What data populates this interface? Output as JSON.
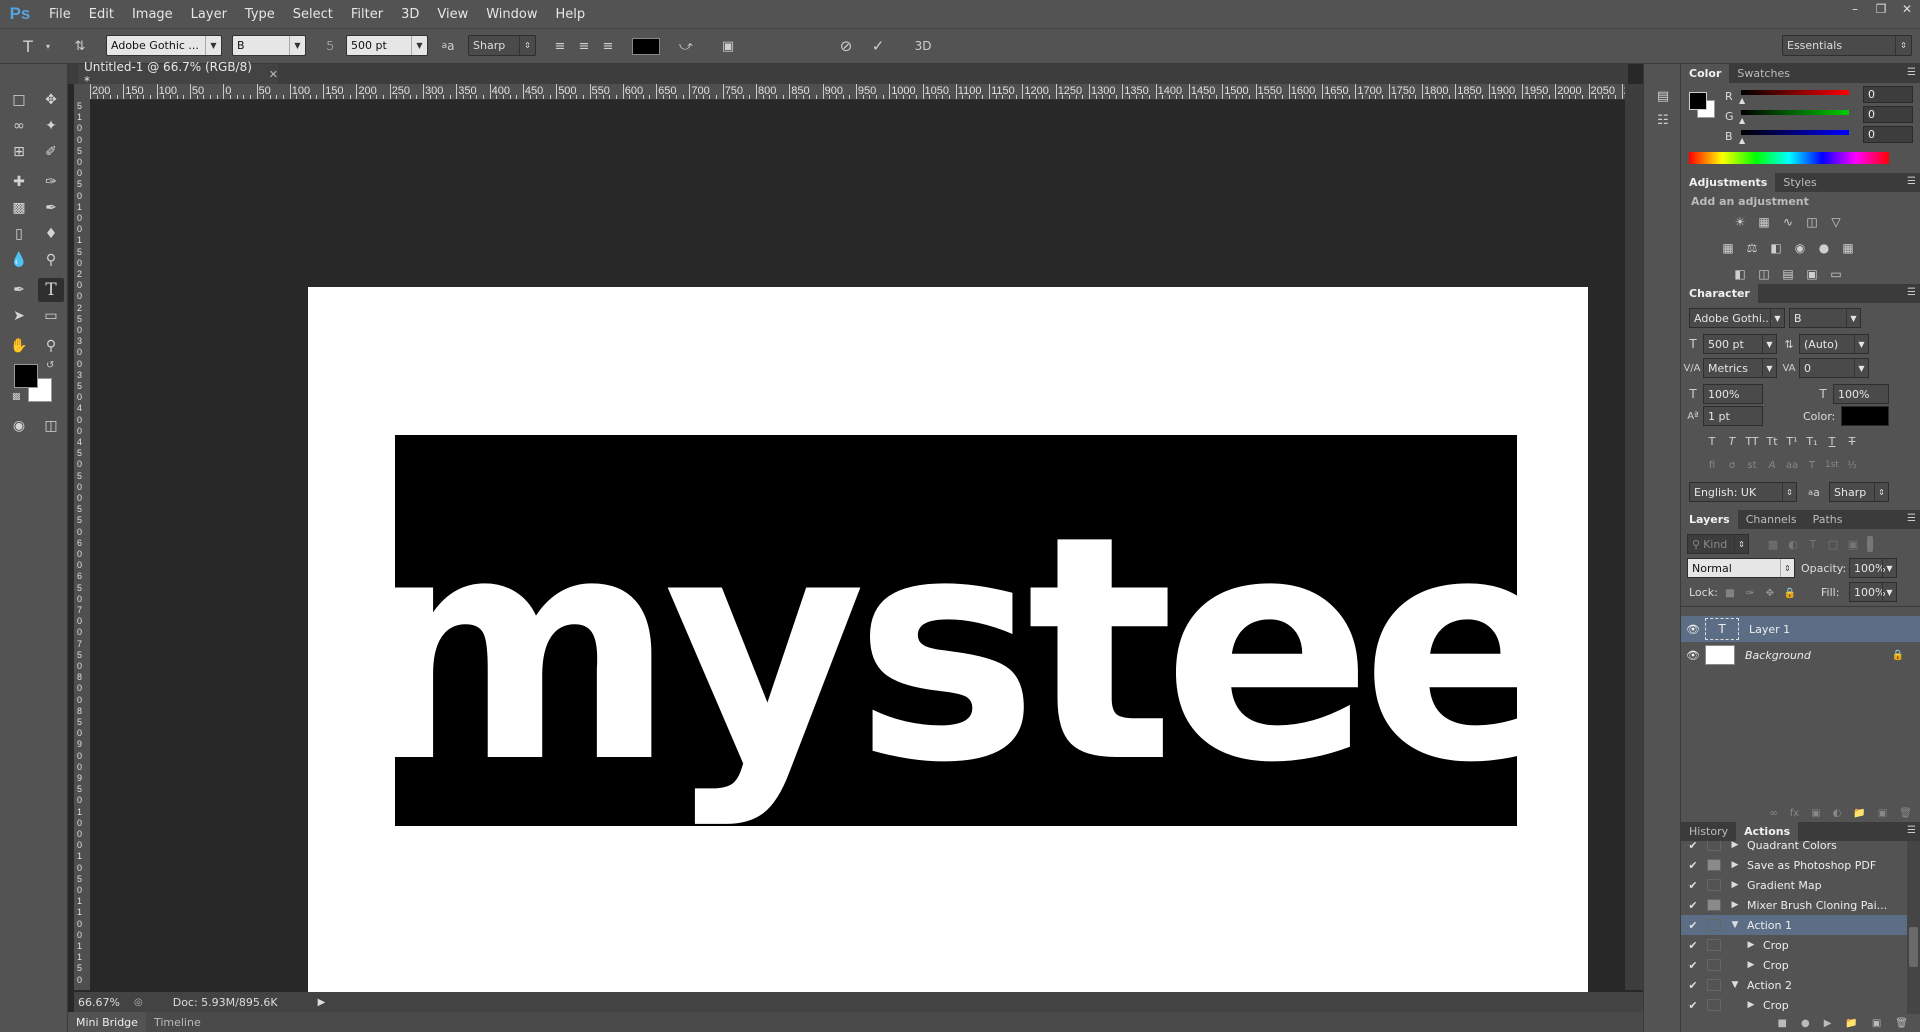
{
  "app": {
    "logo": "Ps",
    "menu": [
      "File",
      "Edit",
      "Image",
      "Layer",
      "Type",
      "Select",
      "Filter",
      "3D",
      "View",
      "Window",
      "Help"
    ],
    "window_controls": [
      "–",
      "❐",
      "✕"
    ]
  },
  "options": {
    "font_family": "Adobe Gothic ...",
    "font_style": "B",
    "font_size": "500 pt",
    "antialias": "Sharp",
    "aa_label": "a",
    "workspace": "Essentials",
    "text_color": "#000000"
  },
  "document": {
    "tab_title": "Untitled-1 @ 66.7% (RGB/8) *",
    "canvas_text": "mystee",
    "zoom": "66.67%",
    "doc_size": "Doc: 5.93M/895.6K",
    "bottom_tabs": [
      "Mini Bridge",
      "Timeline"
    ]
  },
  "ruler": {
    "h_labels": [
      "200",
      "150",
      "100",
      "50",
      "0",
      "50",
      "100",
      "150",
      "200",
      "250",
      "300",
      "350",
      "400",
      "450",
      "500",
      "550",
      "600",
      "650",
      "700",
      "750",
      "800",
      "850",
      "900",
      "950",
      "1000",
      "1050",
      "1100",
      "1150",
      "1200",
      "1250",
      "1300",
      "1350",
      "1400",
      "1450",
      "1500",
      "1550",
      "1600",
      "1650",
      "1700",
      "1750",
      "1800",
      "1850",
      "1900",
      "1950",
      "2000",
      "2050",
      "2"
    ],
    "v_labels": [
      "5",
      "1",
      "0",
      "0",
      "5",
      "0",
      "0",
      "5",
      "0",
      "1",
      "0",
      "0",
      "1",
      "5",
      "0",
      "2",
      "0",
      "0",
      "2",
      "5",
      "0",
      "3",
      "0",
      "0",
      "3",
      "5",
      "0",
      "4",
      "0",
      "0",
      "4",
      "5",
      "0",
      "5",
      "0",
      "0",
      "5",
      "5",
      "0",
      "6",
      "0",
      "0",
      "6",
      "5",
      "0",
      "7",
      "0",
      "0",
      "7",
      "5",
      "0",
      "8",
      "0",
      "0",
      "8",
      "5",
      "0",
      "9",
      "0",
      "0",
      "9",
      "5",
      "0",
      "1",
      "0",
      "0",
      "0",
      "1",
      "0",
      "5",
      "0",
      "1",
      "1",
      "0",
      "0",
      "1",
      "1",
      "5",
      "0"
    ]
  },
  "color_panel": {
    "tabs": [
      "Color",
      "Swatches"
    ],
    "r_label": "R",
    "g_label": "G",
    "b_label": "B",
    "r": "0",
    "g": "0",
    "b": "0"
  },
  "adjustments_panel": {
    "tabs": [
      "Adjustments",
      "Styles"
    ],
    "hint": "Add an adjustment"
  },
  "character_panel": {
    "title": "Character",
    "font_family": "Adobe Gothi...",
    "font_style": "B",
    "size": "500 pt",
    "leading": "(Auto)",
    "kerning": "Metrics",
    "tracking": "0",
    "v_scale": "100%",
    "h_scale": "100%",
    "baseline": "1 pt",
    "color_label": "Color:",
    "language": "English: UK",
    "antialias": "Sharp",
    "aa_label": "a",
    "type_buttons": [
      "T",
      "T",
      "TT",
      "Tt",
      "T¹",
      "T₁",
      "T",
      "T"
    ],
    "otype_buttons": [
      "fi",
      "σ",
      "st",
      "A",
      "aa",
      "T",
      "1st",
      "½"
    ]
  },
  "layers_panel": {
    "tabs": [
      "Layers",
      "Channels",
      "Paths"
    ],
    "kind": "Kind",
    "blend": "Normal",
    "opacity_label": "Opacity:",
    "opacity": "100%",
    "lock_label": "Lock:",
    "fill_label": "Fill:",
    "fill": "100%",
    "layers": [
      {
        "name": "Layer 1",
        "thumb": "T",
        "selected": true
      },
      {
        "name": "Background",
        "thumb": "",
        "selected": false
      }
    ]
  },
  "actions_panel": {
    "tabs": [
      "History",
      "Actions"
    ],
    "items": [
      {
        "name": "Quadrant Colors",
        "indent": 0,
        "open": false,
        "dialog": false,
        "selected": false
      },
      {
        "name": "Save as Photoshop PDF",
        "indent": 0,
        "open": false,
        "dialog": true,
        "selected": false
      },
      {
        "name": "Gradient Map",
        "indent": 0,
        "open": false,
        "dialog": false,
        "selected": false
      },
      {
        "name": "Mixer Brush Cloning Pai...",
        "indent": 0,
        "open": false,
        "dialog": true,
        "selected": false
      },
      {
        "name": "Action 1",
        "indent": 0,
        "open": true,
        "dialog": false,
        "selected": true
      },
      {
        "name": "Crop",
        "indent": 1,
        "open": false,
        "dialog": false,
        "selected": false
      },
      {
        "name": "Crop",
        "indent": 1,
        "open": false,
        "dialog": false,
        "selected": false
      },
      {
        "name": "Action 2",
        "indent": 0,
        "open": true,
        "dialog": false,
        "selected": false
      },
      {
        "name": "Crop",
        "indent": 1,
        "open": false,
        "dialog": false,
        "selected": false
      }
    ]
  }
}
